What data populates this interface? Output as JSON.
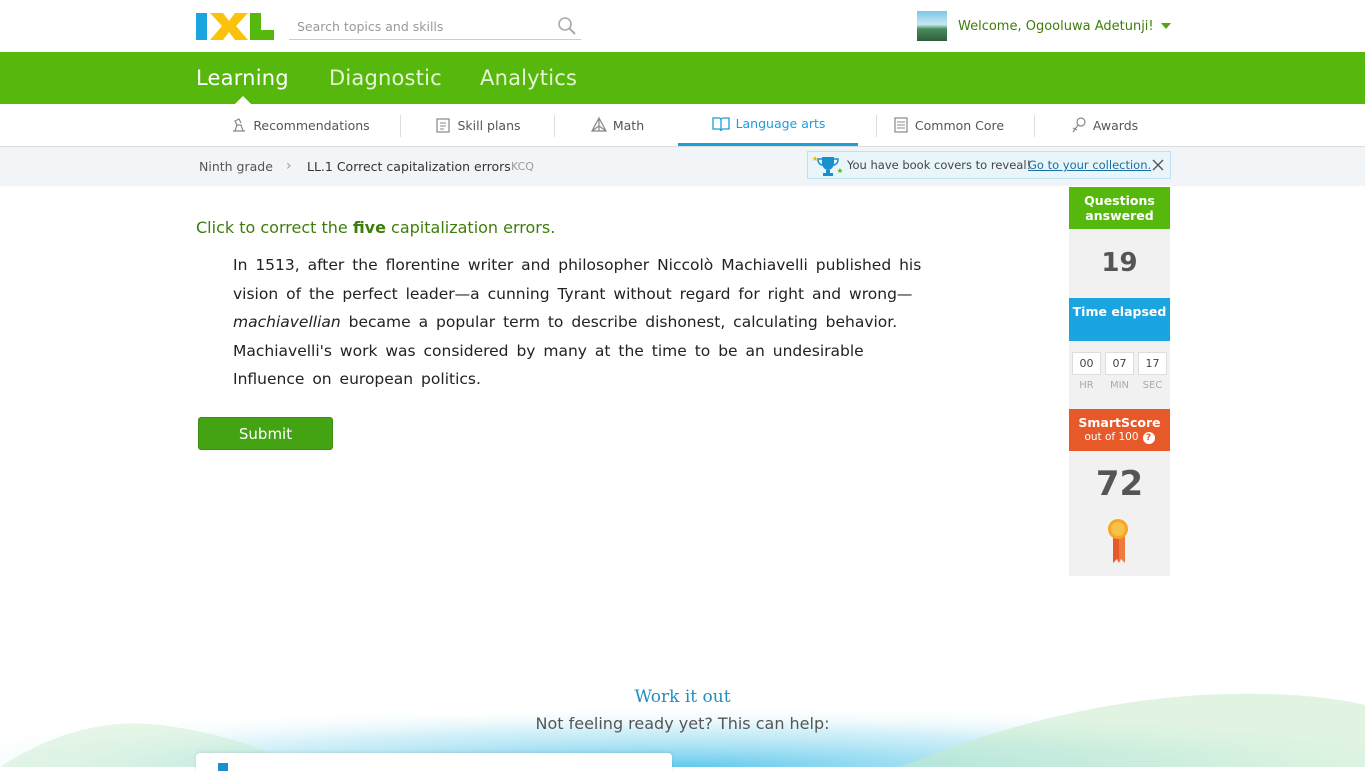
{
  "header": {
    "logo_text": "IXL",
    "search_placeholder": "Search topics and skills",
    "welcome": "Welcome, Ogooluwa Adetunji!"
  },
  "main_nav": {
    "tabs": [
      {
        "label": "Learning",
        "active": true
      },
      {
        "label": "Diagnostic",
        "active": false
      },
      {
        "label": "Analytics",
        "active": false
      }
    ]
  },
  "sub_nav": {
    "items": [
      {
        "label": "Recommendations",
        "icon": "recommendations-icon"
      },
      {
        "label": "Skill plans",
        "icon": "skill-plans-icon"
      },
      {
        "label": "Math",
        "icon": "math-icon"
      },
      {
        "label": "Language arts",
        "icon": "language-arts-icon",
        "active": true
      },
      {
        "label": "Common Core",
        "icon": "common-core-icon"
      },
      {
        "label": "Awards",
        "icon": "awards-icon"
      }
    ]
  },
  "breadcrumb": {
    "grade": "Ninth grade",
    "skill": "LL.1 Correct capitalization errors",
    "code": "KCQ"
  },
  "notice": {
    "text": "You have book covers to reveal!",
    "link": "Go to your collection."
  },
  "question": {
    "prompt_before": "Click to correct the ",
    "prompt_bold": "five",
    "prompt_after": " capitalization errors.",
    "passage": {
      "p1": "In 1513, after the florentine writer and philosopher Niccolò Machiavelli published his vision of the perfect leader—a cunning Tyrant without regard for right and wrong—",
      "italic": "machiavellian",
      "p2": " became a popular term to describe dishonest, calculating behavior. Machiavelli's work was considered by many at the time to be an undesirable Influence on european politics."
    },
    "submit_label": "Submit"
  },
  "sidebar": {
    "questions_label": "Questions answered",
    "questions_value": "19",
    "time_label": "Time elapsed",
    "hr": "00",
    "min": "07",
    "sec": "17",
    "hr_label": "HR",
    "min_label": "MIN",
    "sec_label": "SEC",
    "smartscore_label": "SmartScore",
    "smartscore_sub": "out of 100",
    "smartscore_value": "72"
  },
  "footer": {
    "title": "Work it out",
    "subtitle": "Not feeling ready yet? This can help:"
  },
  "colors": {
    "green": "#56b80c",
    "blue": "#1aa5e0",
    "orange": "#e8592a"
  }
}
